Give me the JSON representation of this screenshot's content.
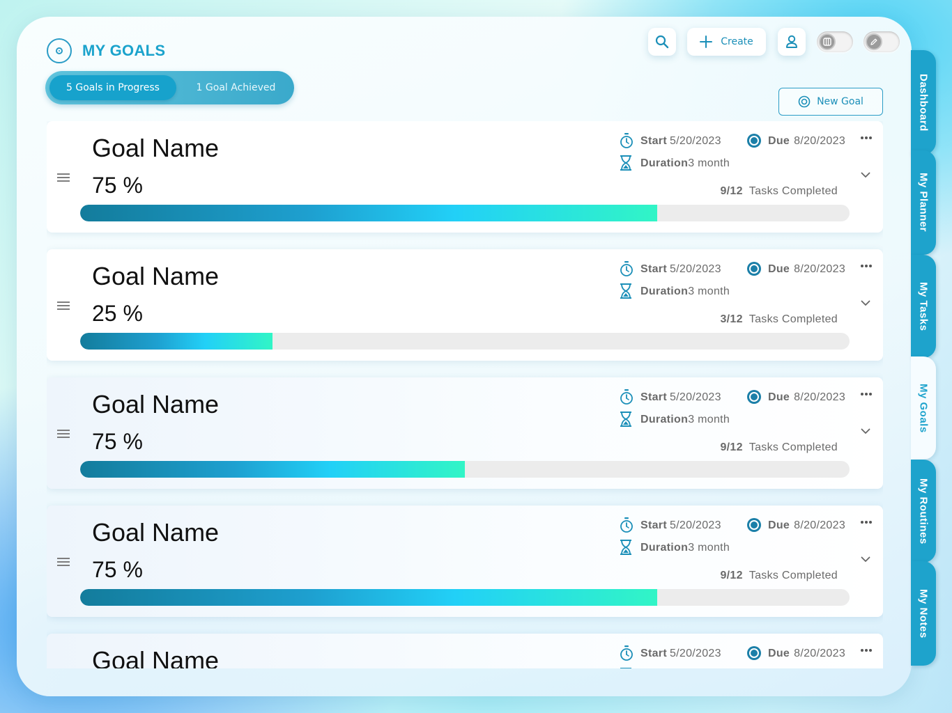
{
  "header": {
    "title": "MY GOALS",
    "filter_active": "5 Goals in Progress",
    "filter_other": "1 Goal Achieved",
    "create_label": "Create",
    "new_goal_label": "New Goal"
  },
  "tabs": [
    {
      "label": "Dashboard",
      "active": false
    },
    {
      "label": "My Planner",
      "active": false
    },
    {
      "label": "My Tasks",
      "active": false
    },
    {
      "label": "My Goals",
      "active": true
    },
    {
      "label": "My Routines",
      "active": false
    },
    {
      "label": "My Notes",
      "active": false
    }
  ],
  "labels": {
    "start": "Start",
    "due": "Due",
    "duration": "Duration",
    "tasks_completed": "Tasks Completed"
  },
  "goals": [
    {
      "name": "Goal Name",
      "percent_text": "75 %",
      "progress": 0.75,
      "start": "5/20/2023",
      "due": "8/20/2023",
      "duration": "3 month",
      "tasks": "9/12"
    },
    {
      "name": "Goal Name",
      "percent_text": "25 %",
      "progress": 0.25,
      "start": "5/20/2023",
      "due": "8/20/2023",
      "duration": "3 month",
      "tasks": "3/12"
    },
    {
      "name": "Goal Name",
      "percent_text": "75 %",
      "progress": 0.5,
      "start": "5/20/2023",
      "due": "8/20/2023",
      "duration": "3 month",
      "tasks": "9/12"
    },
    {
      "name": "Goal Name",
      "percent_text": "75 %",
      "progress": 0.75,
      "start": "5/20/2023",
      "due": "8/20/2023",
      "duration": "3 month",
      "tasks": "9/12"
    },
    {
      "name": "Goal Name",
      "percent_text": "",
      "progress": 0,
      "start": "5/20/2023",
      "due": "8/20/2023",
      "duration": "",
      "tasks": ""
    }
  ],
  "colors": {
    "accent": "#1ea3cc",
    "progress_start": "#137c9c",
    "progress_mid": "#22d0f7",
    "progress_end": "#31f5c6"
  }
}
